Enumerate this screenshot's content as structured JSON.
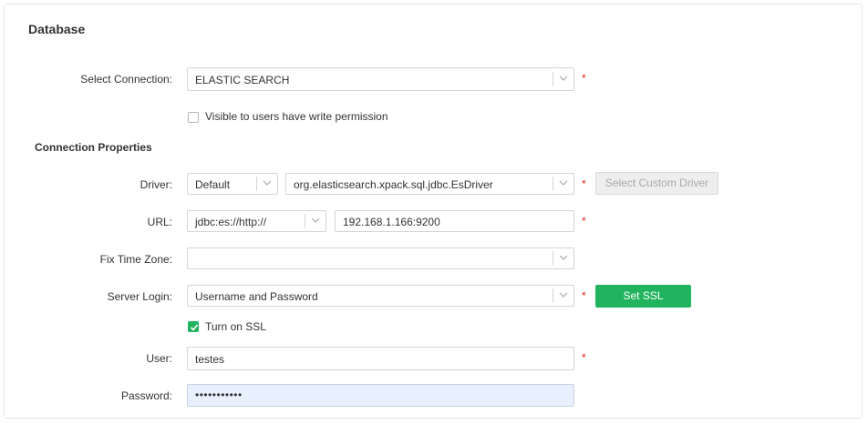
{
  "panel": {
    "title": "Database"
  },
  "connection": {
    "label": "Select Connection:",
    "value": "ELASTIC SEARCH",
    "required_mark": "*",
    "visibility_checkbox_label": "Visible to users have write permission",
    "visibility_checked": false
  },
  "connection_properties": {
    "heading": "Connection Properties",
    "driver": {
      "label": "Driver:",
      "type_value": "Default",
      "class_value": "org.elasticsearch.xpack.sql.jdbc.EsDriver",
      "required_mark": "*",
      "custom_button": "Select Custom Driver"
    },
    "url": {
      "label": "URL:",
      "prefix_value": "jdbc:es://http://",
      "host_value": "192.168.1.166:9200",
      "required_mark": "*"
    },
    "timezone": {
      "label": "Fix Time Zone:",
      "value": ""
    },
    "server_login": {
      "label": "Server Login:",
      "value": "Username and Password",
      "required_mark": "*",
      "ssl_button": "Set SSL",
      "ssl_checkbox_label": "Turn on SSL",
      "ssl_checked": true
    },
    "user": {
      "label": "User:",
      "value": "testes",
      "required_mark": "*"
    },
    "password": {
      "label": "Password:",
      "value": "•••••••••••"
    }
  },
  "colors": {
    "accent_green": "#22b35e",
    "required_red": "#e02020",
    "autofill_blue": "#e8f0fe"
  }
}
